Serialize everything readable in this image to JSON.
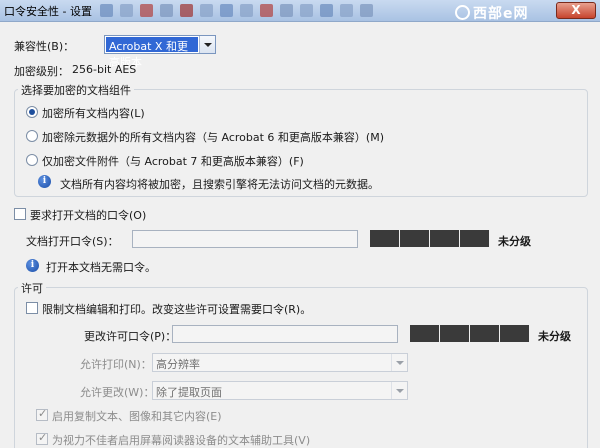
{
  "window": {
    "title": "口令安全性 - 设置",
    "watermark": "西部e网",
    "close_label": "X"
  },
  "compat": {
    "label": "兼容性(B)：",
    "selected": "Acrobat X 和更高版本"
  },
  "encryption": {
    "label": "加密级别：",
    "value": "256-bit AES"
  },
  "components": {
    "legend": "选择要加密的文档组件",
    "options": [
      {
        "label": "加密所有文档内容(L)",
        "checked": true
      },
      {
        "label": "加密除元数据外的所有文档内容（与 Acrobat 6 和更高版本兼容）(M)",
        "checked": false
      },
      {
        "label": "仅加密文件附件（与 Acrobat 7 和更高版本兼容）(F)",
        "checked": false
      }
    ],
    "info": "文档所有内容均将被加密，且搜索引擎将无法访问文档的元数据。"
  },
  "open_password": {
    "checkbox_label": "要求打开文档的口令(O)",
    "field_label": "文档打开口令(S)：",
    "strength": "未分级",
    "info": "打开本文档无需口令。"
  },
  "permissions": {
    "legend": "许可",
    "restrict_label": "限制文档编辑和打印。改变这些许可设置需要口令(R)。",
    "change_pw_label": "更改许可口令(P)：",
    "strength": "未分级",
    "print_label": "允许打印(N)：",
    "print_value": "高分辨率",
    "changes_label": "允许更改(W)：",
    "changes_value": "除了提取页面",
    "copy_label": "启用复制文本、图像和其它内容(E)",
    "accessibility_label": "为视力不佳者启用屏幕阅读器设备的文本辅助工具(V)"
  }
}
